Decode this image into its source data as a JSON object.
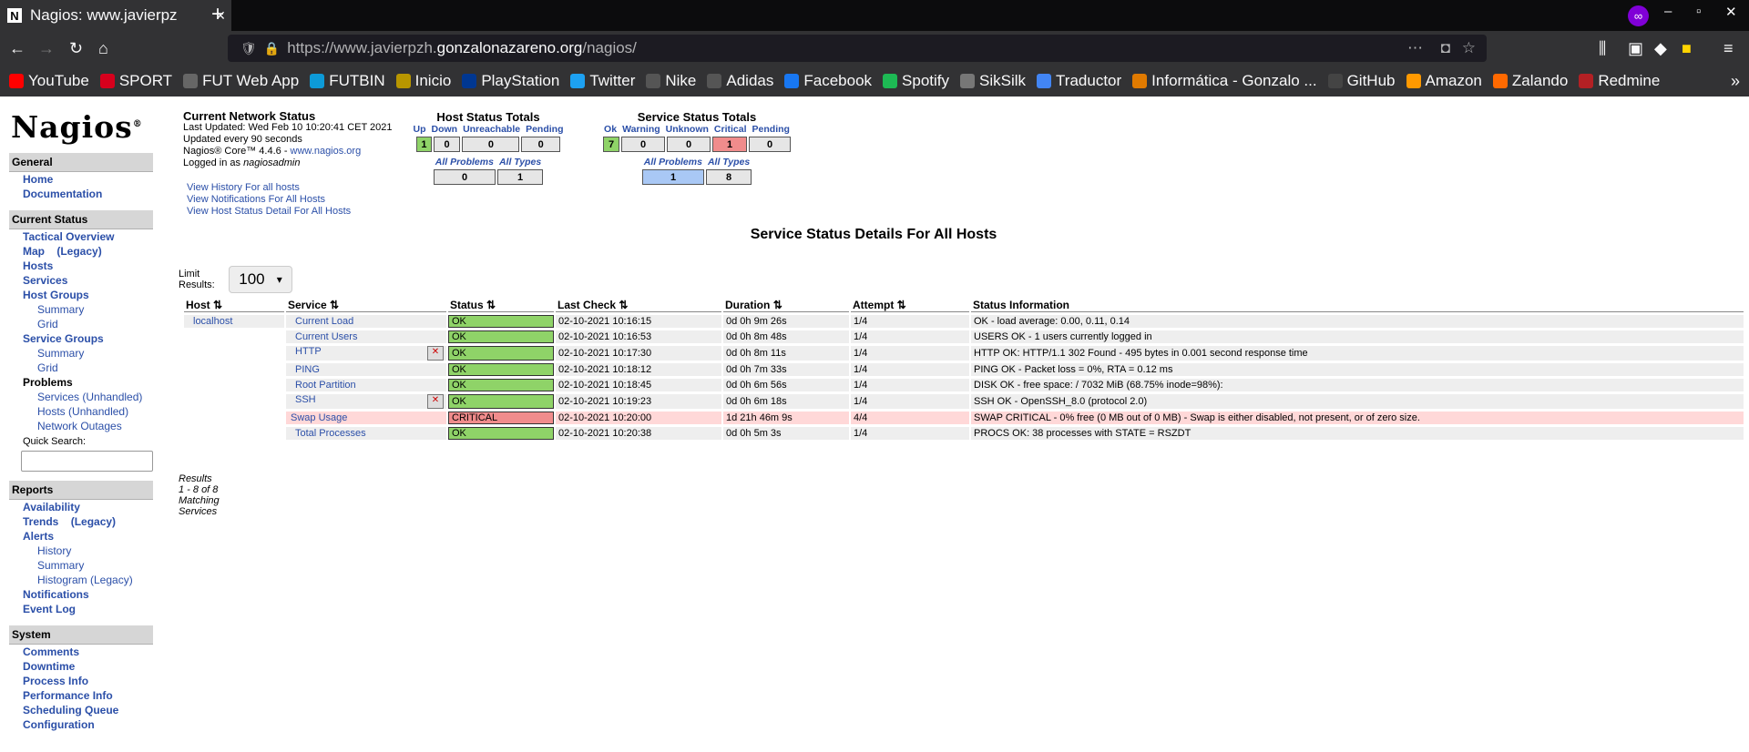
{
  "browser": {
    "tab_title": "Nagios: www.javierpz",
    "url_prefix": "https://www.javierpzh.",
    "url_domain": "gonzalonazareno.org",
    "url_path": "/nagios/"
  },
  "bookmarks": [
    {
      "label": "YouTube",
      "color": "#ff0000"
    },
    {
      "label": "SPORT",
      "color": "#d7001d"
    },
    {
      "label": "FUT Web App",
      "color": "#666666"
    },
    {
      "label": "FUTBIN",
      "color": "#0d9ad7"
    },
    {
      "label": "Inicio",
      "color": "#b89600"
    },
    {
      "label": "PlayStation",
      "color": "#003791"
    },
    {
      "label": "Twitter",
      "color": "#1da1f2"
    },
    {
      "label": "Nike",
      "color": "#555555"
    },
    {
      "label": "Adidas",
      "color": "#555555"
    },
    {
      "label": "Facebook",
      "color": "#1877f2"
    },
    {
      "label": "Spotify",
      "color": "#1db954"
    },
    {
      "label": "SikSilk",
      "color": "#777777"
    },
    {
      "label": "Traductor",
      "color": "#4285f4"
    },
    {
      "label": "Informática - Gonzalo ...",
      "color": "#e07a00"
    },
    {
      "label": "GitHub",
      "color": "#444444"
    },
    {
      "label": "Amazon",
      "color": "#ff9900"
    },
    {
      "label": "Zalando",
      "color": "#ff6900"
    },
    {
      "label": "Redmine",
      "color": "#b32024"
    }
  ],
  "logo": {
    "text": "Nagios",
    "mark": "®"
  },
  "sidebar": {
    "general": "General",
    "home": "Home",
    "documentation": "Documentation",
    "current_status": "Current Status",
    "tactical": "Tactical Overview",
    "map": "Map",
    "legacy": "(Legacy)",
    "hosts": "Hosts",
    "services": "Services",
    "host_groups": "Host Groups",
    "summary": "Summary",
    "grid": "Grid",
    "service_groups": "Service Groups",
    "problems": "Problems",
    "services_unh": "Services",
    "hosts_unh": "Hosts",
    "unhandled": "Unhandled",
    "network_outages": "Network Outages",
    "quick_search": "Quick Search:",
    "reports": "Reports",
    "availability": "Availability",
    "trends": "Trends",
    "alerts": "Alerts",
    "history": "History",
    "histogram": "Histogram (Legacy)",
    "notifications": "Notifications",
    "event_log": "Event Log",
    "system": "System",
    "comments": "Comments",
    "downtime": "Downtime",
    "process_info": "Process Info",
    "performance_info": "Performance Info",
    "scheduling_queue": "Scheduling Queue",
    "configuration": "Configuration"
  },
  "status": {
    "title": "Current Network Status",
    "updated": "Last Updated: Wed Feb 10 10:20:41 CET 2021",
    "interval": "Updated every 90 seconds",
    "version": "Nagios® Core™ 4.4.6 - ",
    "site": "www.nagios.org",
    "logged_prefix": "Logged in as ",
    "user": "nagiosadmin",
    "link_history": "View History For all hosts",
    "link_notifications": "View Notifications For All Hosts",
    "link_hoststatus": "View Host Status Detail For All Hosts"
  },
  "host_totals": {
    "title": "Host Status Totals",
    "headers": [
      "Up",
      "Down",
      "Unreachable",
      "Pending"
    ],
    "values": [
      "1",
      "0",
      "0",
      "0"
    ],
    "sub_headers": [
      "All Problems",
      "All Types"
    ],
    "sub_values": [
      "0",
      "1"
    ]
  },
  "service_totals": {
    "title": "Service Status Totals",
    "headers": [
      "Ok",
      "Warning",
      "Unknown",
      "Critical",
      "Pending"
    ],
    "values": [
      "7",
      "0",
      "0",
      "1",
      "0"
    ],
    "sub_headers": [
      "All Problems",
      "All Types"
    ],
    "sub_values": [
      "1",
      "8"
    ]
  },
  "details_title": "Service Status Details For All Hosts",
  "limit": {
    "label": "Limit Results:",
    "value": "100"
  },
  "table": {
    "headers": [
      "Host",
      "Service",
      "Status",
      "Last Check",
      "Duration",
      "Attempt",
      "Status Information"
    ],
    "host": "localhost",
    "rows": [
      {
        "service": "Current Load",
        "status": "OK",
        "last": "02-10-2021 10:16:15",
        "dur": "0d 0h 9m 26s",
        "att": "1/4",
        "info": "OK - load average: 0.00, 0.11, 0.14"
      },
      {
        "service": "Current Users",
        "status": "OK",
        "last": "02-10-2021 10:16:53",
        "dur": "0d 0h 8m 48s",
        "att": "1/4",
        "info": "USERS OK - 1 users currently logged in"
      },
      {
        "service": "HTTP",
        "status": "OK",
        "last": "02-10-2021 10:17:30",
        "dur": "0d 0h 8m 11s",
        "att": "1/4",
        "info": "HTTP OK: HTTP/1.1 302 Found - 495 bytes in 0.001 second response time"
      },
      {
        "service": "PING",
        "status": "OK",
        "last": "02-10-2021 10:18:12",
        "dur": "0d 0h 7m 33s",
        "att": "1/4",
        "info": "PING OK - Packet loss = 0%, RTA = 0.12 ms"
      },
      {
        "service": "Root Partition",
        "status": "OK",
        "last": "02-10-2021 10:18:45",
        "dur": "0d 0h 6m 56s",
        "att": "1/4",
        "info": "DISK OK - free space: / 7032 MiB (68.75% inode=98%):"
      },
      {
        "service": "SSH",
        "status": "OK",
        "last": "02-10-2021 10:19:23",
        "dur": "0d 0h 6m 18s",
        "att": "1/4",
        "info": "SSH OK - OpenSSH_8.0 (protocol 2.0)"
      },
      {
        "service": "Swap Usage",
        "status": "CRITICAL",
        "last": "02-10-2021 10:20:00",
        "dur": "1d 21h 46m 9s",
        "att": "4/4",
        "info": "SWAP CRITICAL - 0% free (0 MB out of 0 MB) - Swap is either disabled, not present, or of zero size."
      },
      {
        "service": "Total Processes",
        "status": "OK",
        "last": "02-10-2021 10:20:38",
        "dur": "0d 0h 5m 3s",
        "att": "1/4",
        "info": "PROCS OK: 38 processes with STATE = RSZDT"
      }
    ]
  },
  "results": "Results 1 - 8 of 8 Matching Services"
}
